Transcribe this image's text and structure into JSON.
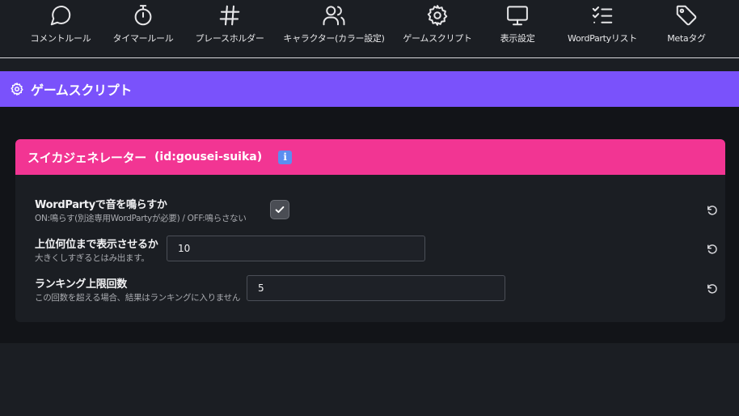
{
  "nav": {
    "items": [
      {
        "label": "コメントルール",
        "icon": "comment-icon"
      },
      {
        "label": "タイマールール",
        "icon": "stopwatch-icon"
      },
      {
        "label": "プレースホルダー",
        "icon": "hash-icon"
      },
      {
        "label": "キャラクター(カラー設定)",
        "icon": "users-icon"
      },
      {
        "label": "ゲームスクリプト",
        "icon": "gear-icon"
      },
      {
        "label": "表示設定",
        "icon": "monitor-icon"
      },
      {
        "label": "WordPartyリスト",
        "icon": "checklist-icon"
      },
      {
        "label": "Metaタグ",
        "icon": "tag-icon"
      }
    ]
  },
  "section": {
    "title": "ゲームスクリプト",
    "icon": "gear-icon",
    "color": "#7a52fb"
  },
  "card": {
    "title": "スイカジェネレーター",
    "id_text": "(id:gousei-suika)",
    "info_icon": "info-icon",
    "header_color": "#f23593",
    "settings": [
      {
        "label": "WordPartyで音を鳴らすか",
        "description": "ON:鳴らす(別途専用WordPartyが必要) / OFF:鳴らさない",
        "type": "checkbox",
        "checked": true
      },
      {
        "label": "上位何位まで表示させるか",
        "description": "大きくしすぎるとはみ出ます。",
        "type": "number",
        "value": "10"
      },
      {
        "label": "ランキング上限回数",
        "description": "この回数を超える場合、結果はランキングに入りません",
        "type": "number",
        "value": "5"
      }
    ],
    "reset_icon": "reset-icon"
  }
}
